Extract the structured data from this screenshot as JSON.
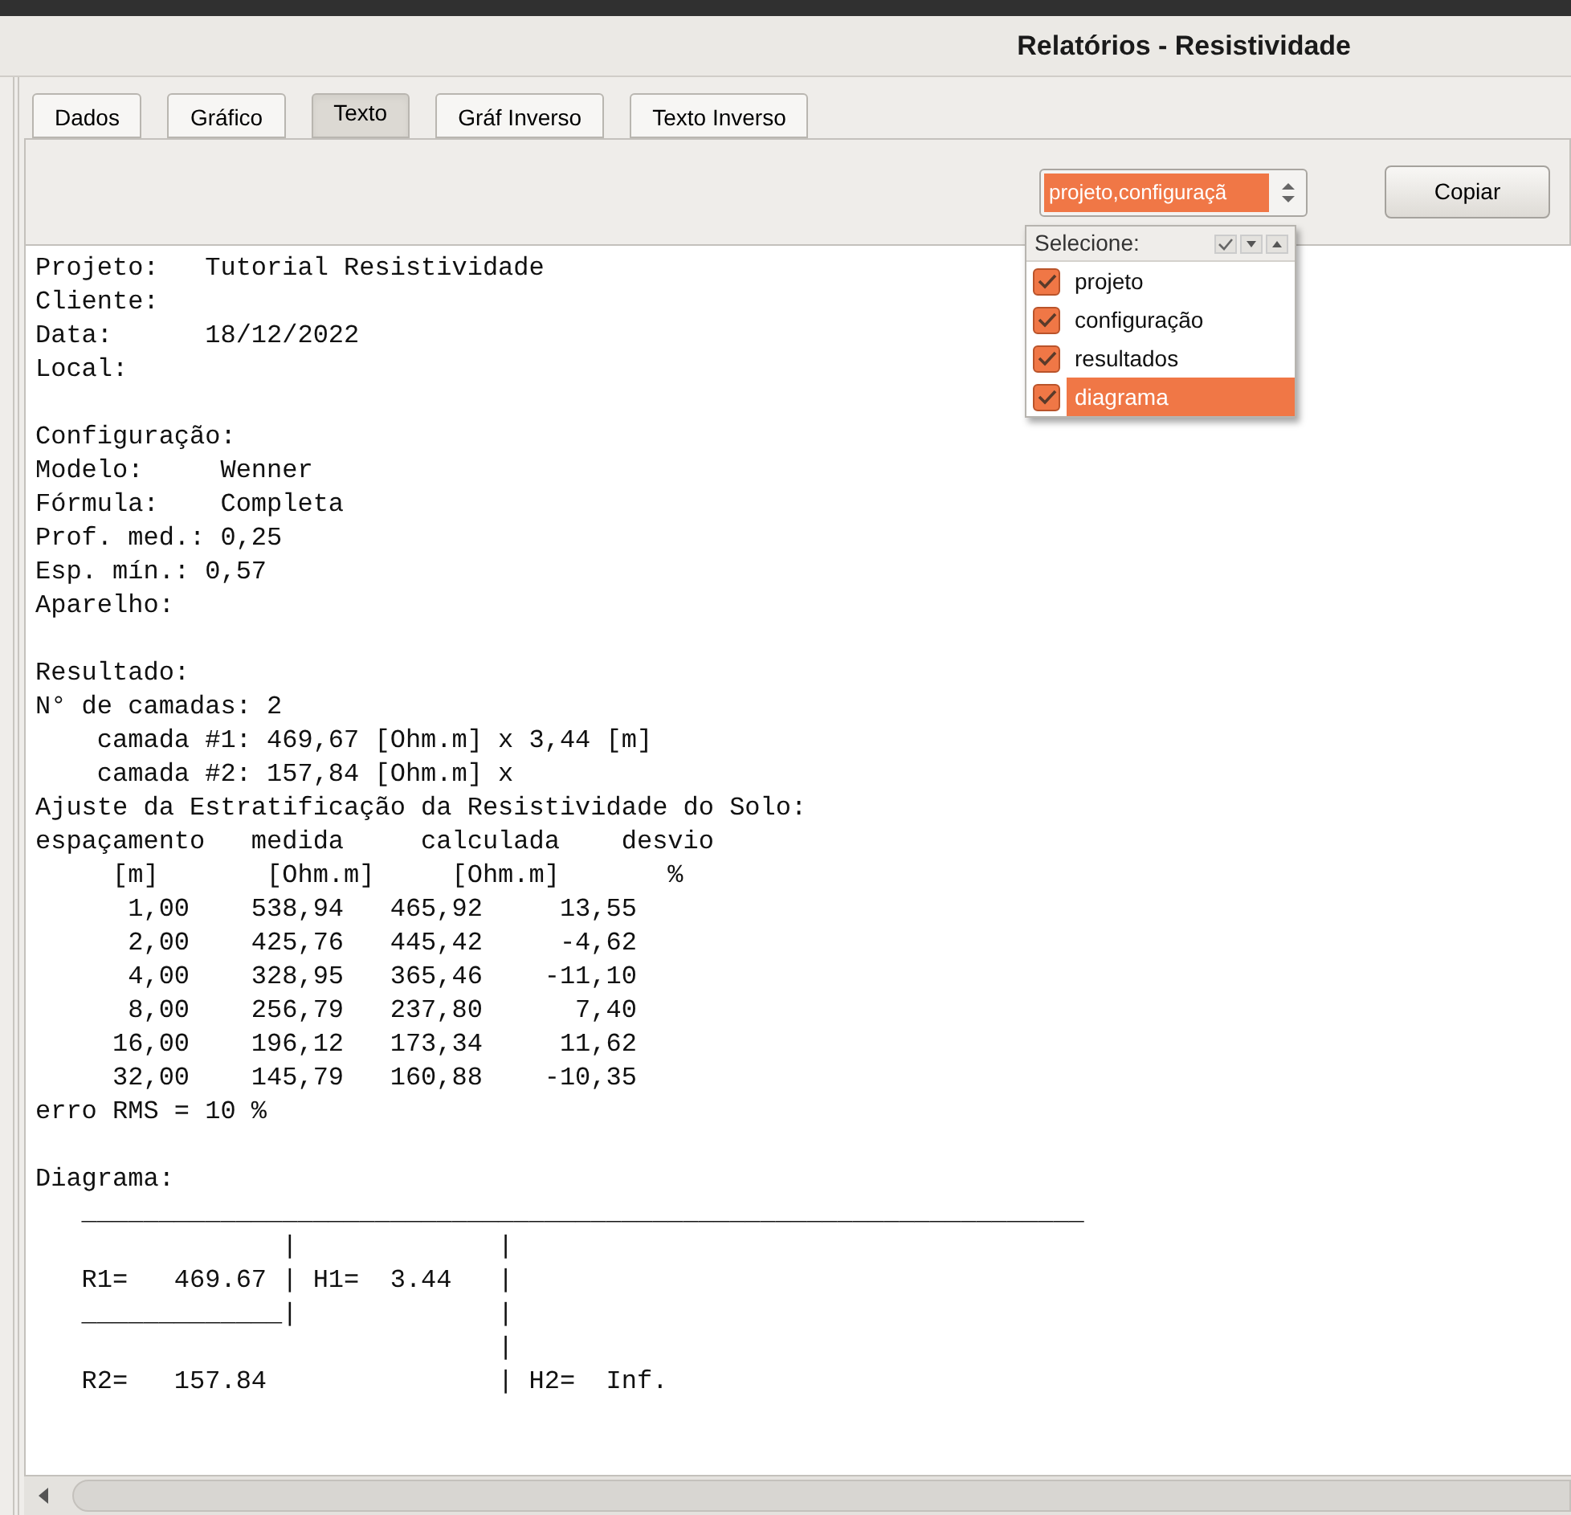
{
  "window": {
    "title": "Relatórios - Resistividade"
  },
  "tabs": [
    {
      "label": "Dados",
      "selected": false
    },
    {
      "label": "Gráfico",
      "selected": false
    },
    {
      "label": "Texto",
      "selected": true
    },
    {
      "label": "Gráf Inverso",
      "selected": false
    },
    {
      "label": "Texto Inverso",
      "selected": false
    }
  ],
  "toolbar": {
    "combo_value": "projeto,configuraçã",
    "copy_button": "Copiar"
  },
  "dropdown": {
    "header": "Selecione:",
    "items": [
      {
        "label": "projeto",
        "checked": true,
        "selected": false
      },
      {
        "label": "configuração",
        "checked": true,
        "selected": false
      },
      {
        "label": "resultados",
        "checked": true,
        "selected": false
      },
      {
        "label": "diagrama",
        "checked": true,
        "selected": true
      }
    ]
  },
  "report": {
    "sections": [
      {
        "lines": [
          "Projeto:   Tutorial Resistividade",
          "Cliente:",
          "Data:      18/12/2022",
          "Local:"
        ]
      },
      {
        "lines": [
          "Configuração:",
          "Modelo:     Wenner",
          "Fórmula:    Completa",
          "Prof. med.: 0,25",
          "Esp. mín.: 0,57",
          "Aparelho:"
        ]
      },
      {
        "lines": [
          "Resultado:",
          "N° de camadas: 2",
          "    camada #1: 469,67 [Ohm.m] x 3,44 [m]",
          "    camada #2: 157,84 [Ohm.m] x",
          "Ajuste da Estratificação da Resistividade do Solo:",
          "espaçamento   medida     calculada    desvio",
          "     [m]       [Ohm.m]     [Ohm.m]       %",
          "      1,00    538,94   465,92     13,55",
          "      2,00    425,76   445,42     -4,62",
          "      4,00    328,95   365,46    -11,10",
          "      8,00    256,79   237,80      7,40",
          "     16,00    196,12   173,34     11,62",
          "     32,00    145,79   160,88    -10,35",
          "erro RMS = 10 %"
        ]
      },
      {
        "lines": [
          "Diagrama:",
          "   _________________________________________________________________",
          "                |             |",
          "   R1=   469.67 | H1=  3.44   |",
          "   _____________|             |",
          "                              |",
          "   R2=   157.84               | H2=  Inf."
        ]
      }
    ]
  }
}
